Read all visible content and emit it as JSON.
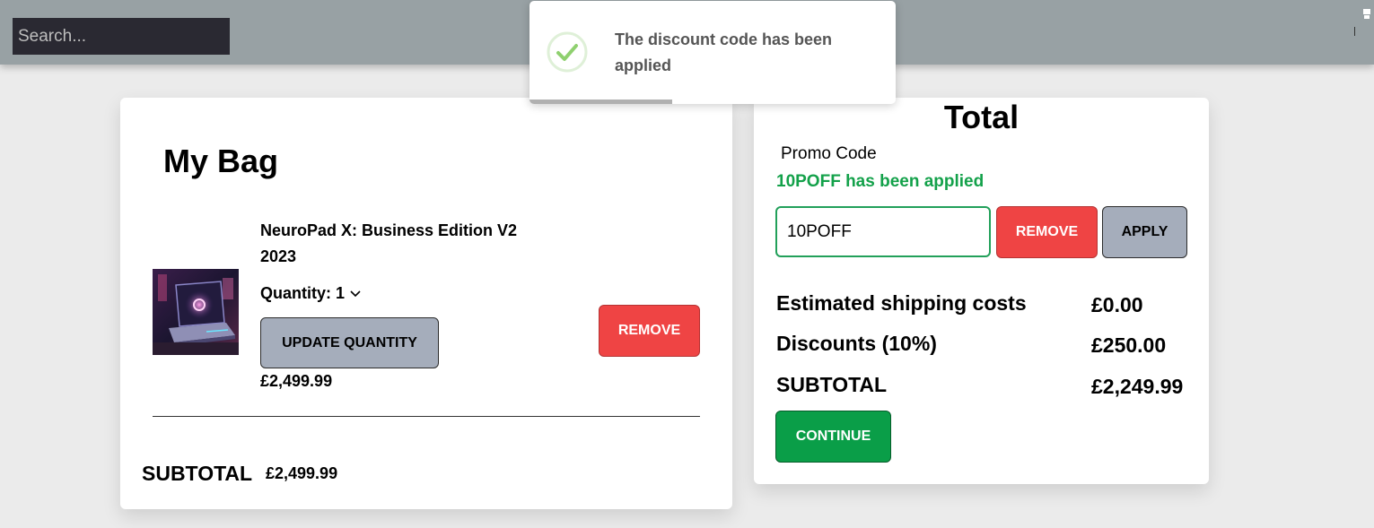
{
  "header": {
    "search_placeholder": "Search..."
  },
  "toast": {
    "message": "The discount code has been applied",
    "icon": "check-circle-icon",
    "progress": 0.39
  },
  "bag": {
    "title": "My Bag",
    "item": {
      "name": "NeuroPad X: Business Edition V2 2023",
      "quantity_label": "Quantity: 1",
      "update_label": "UPDATE QUANTITY",
      "price": "£2,499.99",
      "remove_label": "REMOVE"
    },
    "subtotal_label": "SUBTOTAL",
    "subtotal_value": "£2,499.99"
  },
  "total": {
    "title": "Total",
    "promo_label": "Promo Code",
    "promo_message": "10POFF has been applied",
    "promo_value": "10POFF",
    "remove_label": "REMOVE",
    "apply_label": "APPLY",
    "rows": [
      {
        "label": "Estimated shipping costs",
        "value": "£0.00"
      },
      {
        "label": "Discounts (10%)",
        "value": "£250.00"
      },
      {
        "label": "SUBTOTAL",
        "value": "£2,249.99"
      }
    ],
    "continue_label": "CONTINUE"
  },
  "colors": {
    "header": "#98a1a4",
    "danger": "#ef4444",
    "success": "#0a9e48",
    "neutral_button": "#a5adbb",
    "promo_text": "#13a14a"
  }
}
